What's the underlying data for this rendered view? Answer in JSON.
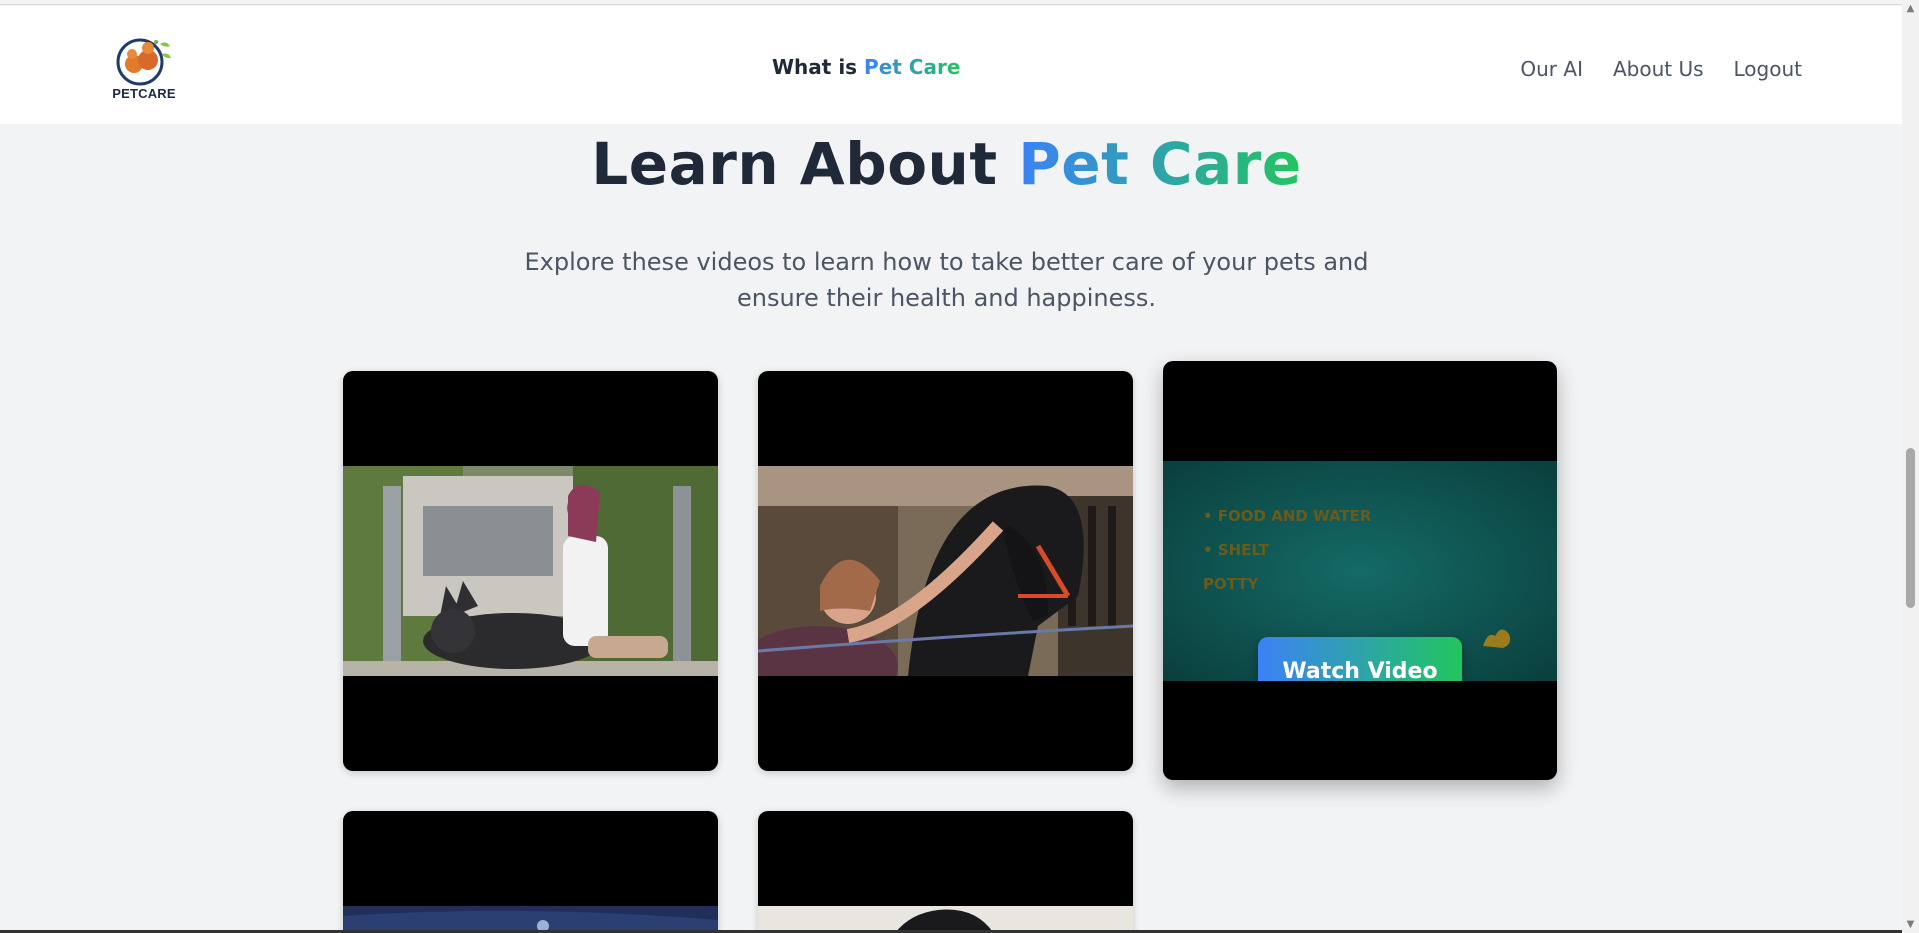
{
  "navbar": {
    "logo_text": "PETCARE",
    "center_prefix": "What is",
    "center_highlight": "Pet Care",
    "links": [
      "Our AI",
      "About Us",
      "Logout"
    ]
  },
  "hero": {
    "title_prefix": "Learn About",
    "title_highlight": "Pet Care",
    "subtitle": "Explore these videos to learn how to take better care of your pets and ensure their health and happiness."
  },
  "videos": {
    "watch_label": "Watch Video",
    "card3_bullets": [
      "• FOOD AND WATER",
      "• SHELT",
      "POTTY"
    ]
  },
  "colors": {
    "gradient_start": "#3b82f6",
    "gradient_end": "#22c55e",
    "heading": "#1f2937",
    "background": "#f2f3f5"
  }
}
